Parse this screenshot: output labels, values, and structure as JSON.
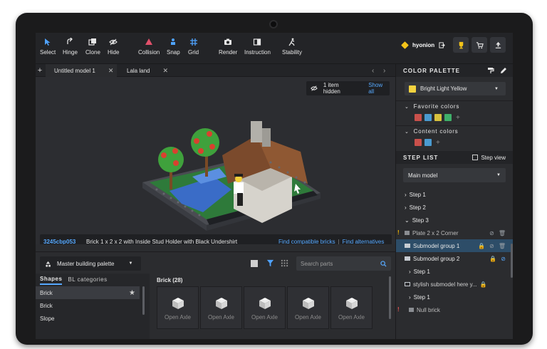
{
  "toolbar": {
    "tools": [
      {
        "label": "Select",
        "icon": "cursor-icon"
      },
      {
        "label": "Hinge",
        "icon": "hinge-icon"
      },
      {
        "label": "Clone",
        "icon": "clone-icon"
      },
      {
        "label": "Hide",
        "icon": "eye-off-icon"
      },
      {
        "label": "Collision",
        "icon": "warning-icon"
      },
      {
        "label": "Snap",
        "icon": "snap-icon"
      },
      {
        "label": "Grid",
        "icon": "grid-icon"
      },
      {
        "label": "Render",
        "icon": "camera-icon"
      },
      {
        "label": "Instruction",
        "icon": "book-icon"
      },
      {
        "label": "Stability",
        "icon": "stability-icon"
      }
    ],
    "username": "hyonion"
  },
  "tabs": [
    {
      "label": "Untitled model 1"
    },
    {
      "label": "Lala land"
    }
  ],
  "viewport": {
    "hidden_text": "1 item hidden",
    "show_all": "Show all",
    "part_code": "3245cbp053",
    "part_name": "Brick 1 x 2 x 2 with Inside Stud Holder with Black Undershirt",
    "find_compatible": "Find compatible bricks",
    "separator": "|",
    "find_alternatives": "Find alternatives"
  },
  "parts": {
    "palette": "Master building palette",
    "search_placeholder": "Search parts",
    "subtab_shapes": "Shapes",
    "subtab_bl": "BL categories",
    "shape_list": [
      "Brick",
      "Brick",
      "Slope"
    ],
    "grid_title": "Brick (28)",
    "grid_items": [
      "Open Axle",
      "Open Axle",
      "Open Axle",
      "Open Axle",
      "Open Axle"
    ]
  },
  "color_palette": {
    "title": "COLOR PALETTE",
    "selected": "Bright Light Yellow",
    "selected_hex": "#f3d23f",
    "favorite_title": "Favorite colors",
    "favorites": [
      "#c9504b",
      "#4a9ad0",
      "#d8c13d",
      "#3faf6a"
    ],
    "content_title": "Content colors",
    "content": [
      "#c9504b",
      "#4a9ad0"
    ]
  },
  "step_list": {
    "title": "STEP LIST",
    "step_view": "Step view",
    "model": "Main model",
    "rows": [
      {
        "label": "Step 1",
        "type": "step"
      },
      {
        "label": "Step 2",
        "type": "step"
      },
      {
        "label": "Step 3",
        "type": "step"
      },
      {
        "label": "Plate 2 x 2 Corner",
        "type": "part",
        "warn": "!"
      },
      {
        "label": "Submodel group 1",
        "type": "group"
      },
      {
        "label": "Submodel group 2",
        "type": "group"
      },
      {
        "label": "Step 1",
        "type": "step"
      },
      {
        "label": "stylish submodel here y...",
        "type": "group"
      },
      {
        "label": "Step 1",
        "type": "step"
      },
      {
        "label": "Null brick",
        "type": "part",
        "warn": "!"
      }
    ]
  }
}
